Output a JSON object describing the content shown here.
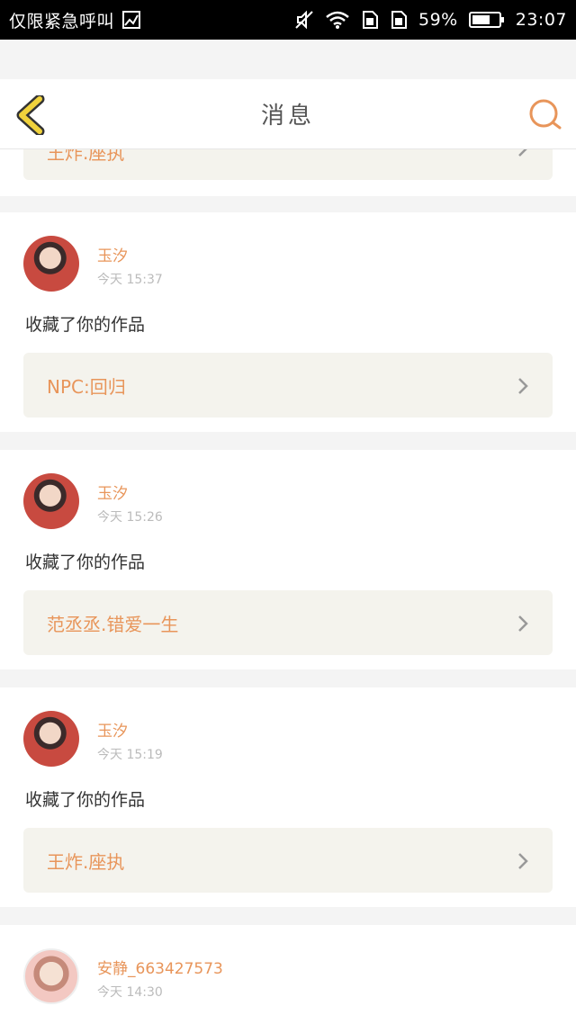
{
  "status_bar": {
    "carrier_text": "仅限紧急呼叫",
    "battery_percent": "59%",
    "time": "23:07",
    "icons": [
      "image-icon",
      "mute-icon",
      "wifi-icon",
      "sim1-icon",
      "sim2-icon",
      "battery-icon"
    ]
  },
  "header": {
    "title": "消息",
    "back_icon": "chevron-left-icon",
    "search_icon": "search-icon"
  },
  "colors": {
    "accent": "#e8955a",
    "back_arrow": "#f0d23c",
    "back_arrow_outline": "#333333",
    "card_bg": "#ffffff",
    "page_bg": "#f4f4f4",
    "work_box_bg": "#f4f3ed"
  },
  "partial_top": {
    "work_title": "王炸.座执"
  },
  "messages": [
    {
      "username": "玉汐",
      "time": "今天 15:37",
      "action": "收藏了你的作品",
      "work_title": "NPC:回归"
    },
    {
      "username": "玉汐",
      "time": "今天 15:26",
      "action": "收藏了你的作品",
      "work_title": "范丞丞.错爱一生"
    },
    {
      "username": "玉汐",
      "time": "今天 15:19",
      "action": "收藏了你的作品",
      "work_title": "王炸.座执"
    },
    {
      "username": "安静_663427573",
      "time": "今天 14:30"
    }
  ]
}
